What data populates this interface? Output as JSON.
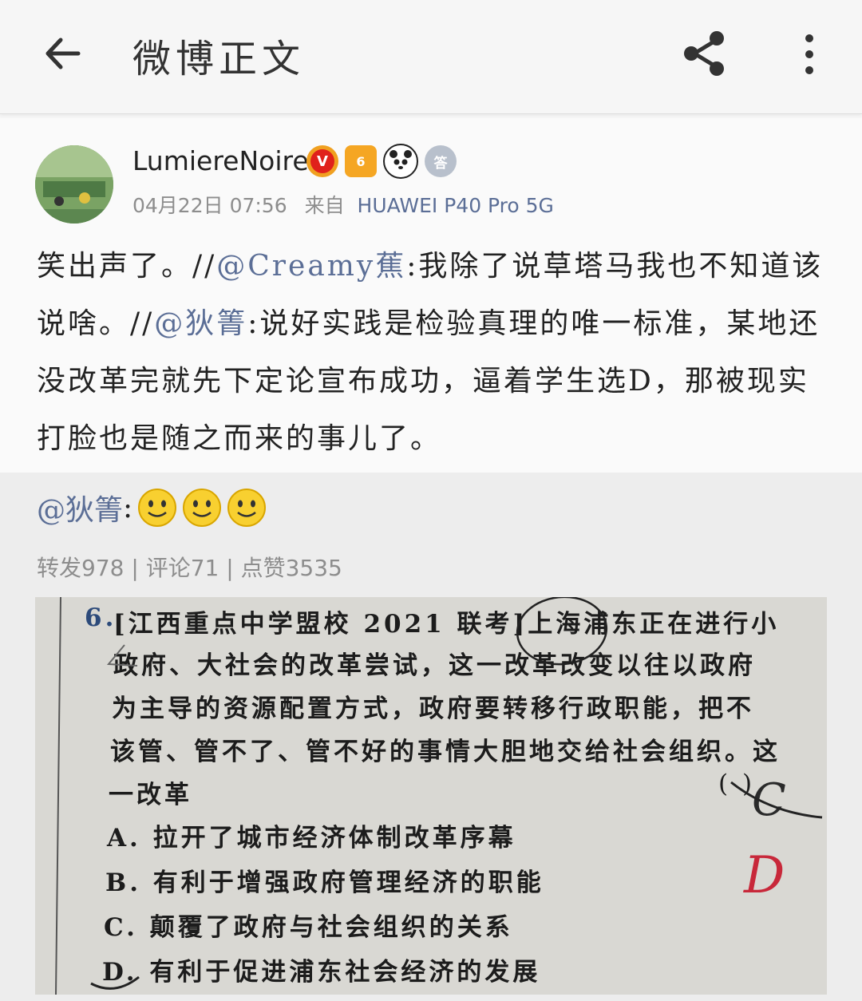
{
  "header": {
    "title": "微博正文"
  },
  "post": {
    "username": "LumiereNoire",
    "badge_level": "6",
    "badge_medal": "答",
    "date": "04月22日 07:56",
    "from_label": "来自",
    "source": "HUAWEI P40 Pro 5G",
    "text_a": "笑出声了。//",
    "mention1": "@Creamy蕉",
    "text_b": ":我除了说草塔马我也不知道该说啥。//",
    "mention2": "@狄箐",
    "text_c": ":说好实践是检验真理的唯一标准，某地还没改革完就先下定论宣布成功，逼着学生选D，那被现实打脸也是随之而来的事儿了。"
  },
  "repost": {
    "mention": "@狄箐",
    "colon": ":",
    "stats": {
      "reposts": "转发978",
      "comments": "评论71",
      "likes": "点赞3535",
      "sep": " | "
    }
  },
  "photo": {
    "num": "6.",
    "l1": "[江西重点中学盟校 2021 联考]上海浦东正在进行小",
    "l2": "政府、大社会的改革尝试，这一改革改变以往以政府",
    "l3": "为主导的资源配置方式，政府要转移行政职能，把不",
    "l4": "该管、管不了、管不好的事情大胆地交给社会组织。这",
    "l5": "一改革",
    "bracket": "(   )",
    "a": "A. 拉开了城市经济体制改革序幕",
    "b": "B. 有利于增强政府管理经济的职能",
    "c": "C. 颠覆了政府与社会组织的关系",
    "d": "D. 有利于促进浦东社会经济的发展",
    "mark1": "C",
    "mark2": "D"
  }
}
